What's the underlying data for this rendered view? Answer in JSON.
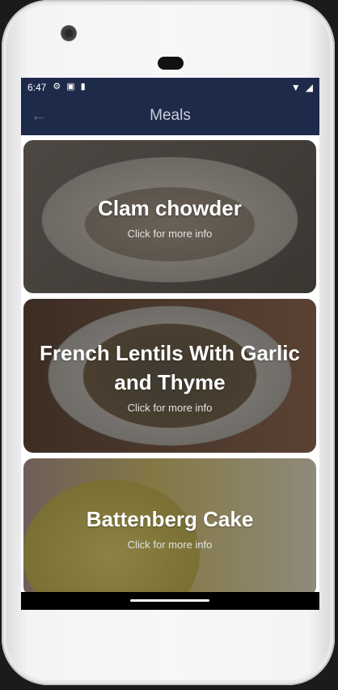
{
  "status": {
    "time": "6:47"
  },
  "appbar": {
    "title": "Meals",
    "back_icon": "←"
  },
  "meals": [
    {
      "title": "Clam chowder",
      "subtitle": "Click for more info"
    },
    {
      "title": "French Lentils With Garlic and Thyme",
      "subtitle": "Click for more info"
    },
    {
      "title": "Battenberg Cake",
      "subtitle": "Click for more info"
    }
  ],
  "colors": {
    "appbar": "#1e2a4a",
    "title": "#c9ceda"
  }
}
